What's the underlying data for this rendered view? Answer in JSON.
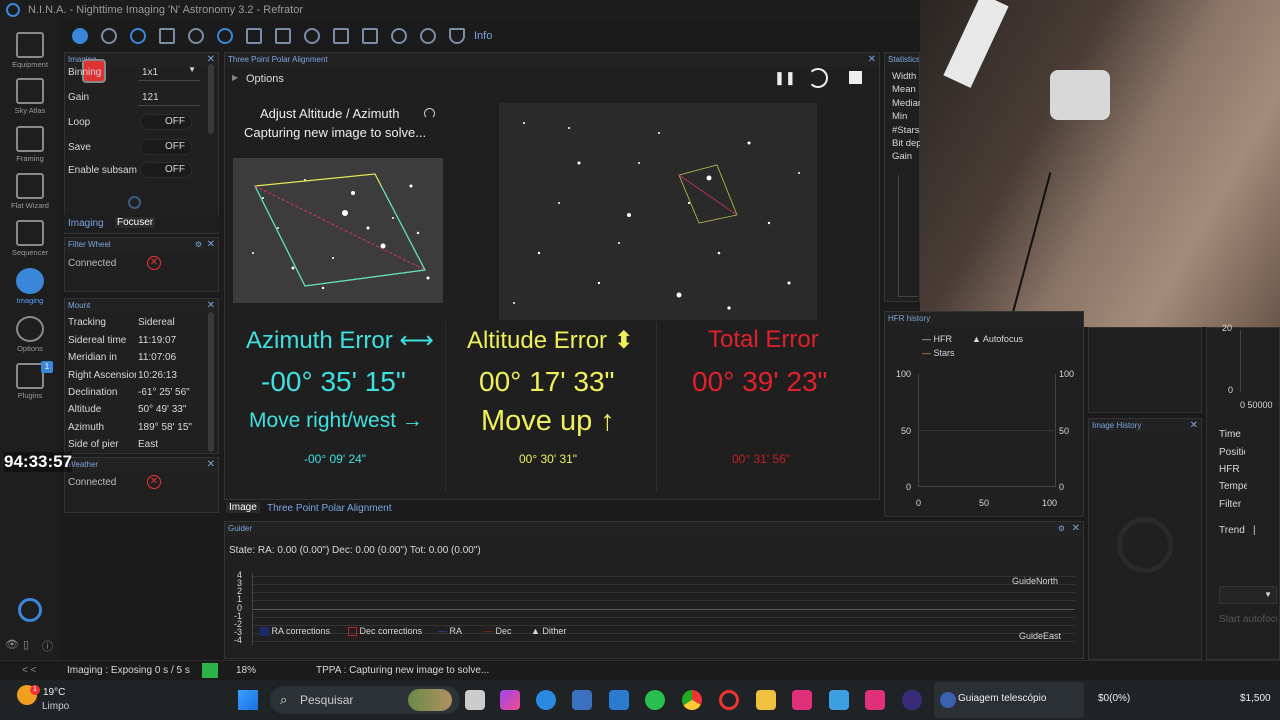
{
  "window": {
    "title": "N.I.N.A. - Nighttime Imaging 'N' Astronomy 3.2  -  Refrator"
  },
  "nav": {
    "items": [
      {
        "label": "Equipment"
      },
      {
        "label": "Sky Atlas"
      },
      {
        "label": "Framing"
      },
      {
        "label": "Flat Wizard"
      },
      {
        "label": "Sequencer"
      },
      {
        "label": "Imaging"
      },
      {
        "label": "Options"
      },
      {
        "label": "Plugins"
      }
    ],
    "plugins_badge": "1",
    "collapse": "< <"
  },
  "toolbar": {
    "info": "Info"
  },
  "imaging_panel": {
    "title": "Imaging",
    "rows": [
      {
        "label": "Binning",
        "value": "1x1"
      },
      {
        "label": "Gain",
        "value": "121"
      },
      {
        "label": "Loop",
        "value": "OFF"
      },
      {
        "label": "Save",
        "value": "OFF"
      },
      {
        "label": "Enable subsam",
        "value": "OFF"
      }
    ],
    "tabs": [
      "Imaging",
      "Focuser"
    ]
  },
  "filter_wheel": {
    "title": "Filter Wheel",
    "status": "Connected"
  },
  "mount": {
    "title": "Mount",
    "rows": [
      {
        "label": "Tracking",
        "value": "Sidereal"
      },
      {
        "label": "Sidereal time",
        "value": "11:19:07"
      },
      {
        "label": "Meridian in",
        "value": "11:07:06"
      },
      {
        "label": "Right Ascension",
        "value": "10:26:13"
      },
      {
        "label": "Declination",
        "value": "-61° 25' 56\""
      },
      {
        "label": "Altitude",
        "value": "50° 49' 33\""
      },
      {
        "label": "Azimuth",
        "value": "189° 58' 15\""
      },
      {
        "label": "Side of pier",
        "value": "East"
      }
    ]
  },
  "weather": {
    "title": "Weather",
    "status": "Connected"
  },
  "overlay_timer": "94:33:57",
  "tppa": {
    "title": "Three Point Polar Alignment",
    "options": "Options",
    "step_title": "Adjust Altitude / Azimuth",
    "step_status": "Capturing new image to solve...",
    "azimuth": {
      "label": "Azimuth Error",
      "arrow": "⟷",
      "value": "-00° 35' 15\"",
      "move": "Move right/west",
      "move_arrow": "→",
      "sub": "-00° 09' 24\""
    },
    "altitude": {
      "label": "Altitude Error",
      "arrow": "⬍",
      "value": "00° 17' 33\"",
      "move": "Move up",
      "move_arrow": "↑",
      "sub": "00° 30' 31\""
    },
    "total": {
      "label": "Total Error",
      "value": "00° 39' 23\"",
      "sub": "00° 31' 56\""
    },
    "tabs": [
      "Image",
      "Three Point Polar Alignment"
    ],
    "colors": {
      "azimuth": "#3ee0e0",
      "altitude": "#f0f05a",
      "total": "#e0202a"
    }
  },
  "statistics": {
    "title": "Statistics",
    "rows": [
      "Width",
      "Mean",
      "Median",
      "Min",
      "#Stars",
      "Bit depth",
      "Gain"
    ]
  },
  "hfr_history": {
    "title": "HFR history",
    "legend": [
      "HFR",
      "Autofocus",
      "Stars"
    ],
    "y_ticks": [
      "100",
      "50",
      "0"
    ],
    "x_ticks": [
      "0",
      "50",
      "100"
    ]
  },
  "image_history": {
    "title": "Image History"
  },
  "right_panel": {
    "y_top": "20",
    "y_zero": "0",
    "x_ticks": "0 50000",
    "labels": [
      "Time",
      "Position",
      "HFR",
      "Temperature",
      "Filter",
      "Trend"
    ],
    "trend_value": "|",
    "start_button": "Start autofocus"
  },
  "guider": {
    "title": "Guider",
    "state": "State:  RA: 0.00 (0.00\")  Dec: 0.00 (0.00\")  Tot: 0.00 (0.00\")",
    "y_ticks": [
      "4",
      "3",
      "2",
      "1",
      "0",
      "-1",
      "-2",
      "-3",
      "-4"
    ],
    "north": "GuideNorth",
    "east": "GuideEast",
    "legend": [
      "RA corrections",
      "Dec corrections",
      "RA",
      "Dec",
      "Dither"
    ]
  },
  "status": {
    "imaging": "Imaging :   Exposing 0 s / 5 s",
    "progress": "18%",
    "progress_fraction": 0.18,
    "tppa": "TPPA :   Capturing new image to solve..."
  },
  "taskbar": {
    "temp": "19°C",
    "weather": "Limpo",
    "weather_badge": "1",
    "search": "Pesquisar",
    "active_window": "Guiagem telescópio",
    "ticker1": "$0(0%)",
    "ticker2": "$1,500"
  }
}
